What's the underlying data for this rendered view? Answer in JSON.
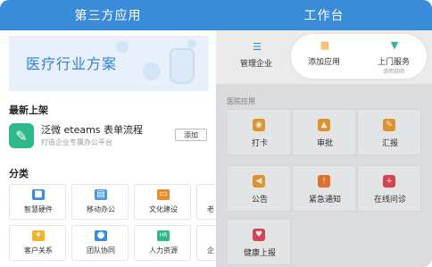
{
  "left": {
    "header_title": "第三方应用",
    "banner_text": "医疗行业方案",
    "latest_title": "最新上架",
    "app": {
      "name": "泛微 eteams 表单流程",
      "subtitle": "打造企业专属办公平台",
      "add_label": "添加"
    },
    "category_title": "分类",
    "categories": [
      {
        "label": "智慧硬件",
        "icon": "cube-icon",
        "color": "#3a8bd8"
      },
      {
        "label": "移动办公",
        "icon": "document-icon",
        "color": "#4a9be0"
      },
      {
        "label": "文化建设",
        "icon": "book-icon",
        "color": "#e98b2a"
      },
      {
        "label": "客户关系",
        "icon": "handshake-icon",
        "color": "#f0b428"
      },
      {
        "label": "团队协同",
        "icon": "team-icon",
        "color": "#3a8bd8"
      },
      {
        "label": "人力资源",
        "icon": "hr-icon",
        "color": "#2fb88b"
      }
    ],
    "partial_category_labels": [
      "老",
      "企"
    ]
  },
  "right": {
    "header_title": "工作台",
    "quick_actions": [
      {
        "label": "管理企业",
        "icon": "sliders-icon",
        "color": "#3a8bd8",
        "sub": ""
      },
      {
        "label": "添加应用",
        "icon": "grid-plus-icon",
        "color": "#f0a030",
        "sub": ""
      },
      {
        "label": "上门服务",
        "icon": "tie-icon",
        "color": "#2fb88b",
        "sub": "说明说明"
      }
    ],
    "group_title": "医院应用",
    "apps": [
      {
        "label": "打卡",
        "icon": "location-icon",
        "color": "#f0a030"
      },
      {
        "label": "审批",
        "icon": "stamp-icon",
        "color": "#f0a030"
      },
      {
        "label": "汇报",
        "icon": "report-icon",
        "color": "#f0a030"
      },
      {
        "label": "公告",
        "icon": "megaphone-icon",
        "color": "#f0a030"
      },
      {
        "label": "紧急通知",
        "icon": "alert-icon",
        "color": "#f07a30"
      },
      {
        "label": "在线问诊",
        "icon": "medical-icon",
        "color": "#e84a5a"
      },
      {
        "label": "健康上报",
        "icon": "health-report-icon",
        "color": "#e84a5a"
      }
    ]
  }
}
